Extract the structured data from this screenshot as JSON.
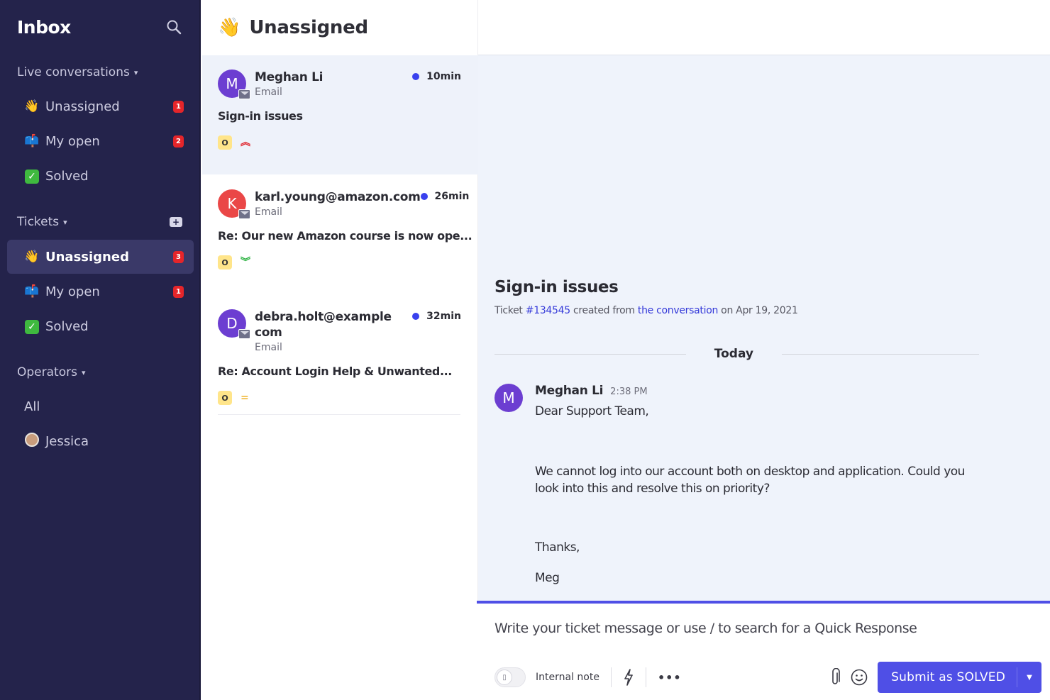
{
  "sidebar": {
    "title": "Inbox",
    "search_icon": "search-icon",
    "sections": {
      "live": {
        "label": "Live conversations",
        "items": [
          {
            "label": "Unassigned",
            "emoji": "👋",
            "badge": "1"
          },
          {
            "label": "My open",
            "emoji": "📫",
            "badge": "2"
          },
          {
            "label": "Solved",
            "emoji": "✓",
            "badge": ""
          }
        ]
      },
      "tickets": {
        "label": "Tickets",
        "add_icon": "new-ticket-icon",
        "items": [
          {
            "label": "Unassigned",
            "emoji": "👋",
            "badge": "3",
            "active": true
          },
          {
            "label": "My open",
            "emoji": "📫",
            "badge": "1"
          },
          {
            "label": "Solved",
            "emoji": "✓",
            "badge": ""
          }
        ]
      },
      "operators": {
        "label": "Operators",
        "items": [
          {
            "label": "All"
          },
          {
            "label": "Jessica"
          }
        ]
      }
    }
  },
  "list": {
    "title": "Unassigned",
    "emoji": "👋",
    "conversations": [
      {
        "initial": "M",
        "name": "Meghan Li",
        "channel": "Email",
        "time": "10min",
        "subject": "Sign-in issues",
        "tag": "O",
        "priority": "high",
        "priority_glyph": "︽",
        "avatar_color": "#6c3ed1",
        "selected": true
      },
      {
        "initial": "K",
        "name": "karl.young@amazon.com",
        "channel": "Email",
        "time": "26min",
        "subject": "Re: Our new Amazon course is now ope...",
        "tag": "O",
        "priority": "low",
        "priority_glyph": "︾",
        "avatar_color": "#ea4747"
      },
      {
        "initial": "D",
        "name": "debra.holt@example com",
        "channel": "Email",
        "time": "32min",
        "subject": "Re: Account Login Help & Unwanted...",
        "tag": "O",
        "priority": "medium",
        "priority_glyph": "=",
        "avatar_color": "#6c3ed1"
      }
    ]
  },
  "ticket": {
    "title": "Sign-in issues",
    "meta_prefix": "Ticket ",
    "ticket_id": "#134545",
    "meta_mid": " created from ",
    "conversation_link": "the conversation",
    "meta_suffix": " on Apr 19, 2021",
    "day_divider": "Today",
    "message": {
      "author_initial": "M",
      "author": "Meghan Li",
      "time": "2:38 PM",
      "lines": [
        "Dear Support Team,",
        "We cannot log into our account both on desktop and application. Could you",
        "look into this and resolve this on priority?",
        "Thanks,",
        "Meg"
      ]
    }
  },
  "composer": {
    "placeholder": "Write your ticket message or use / to search for a Quick Response",
    "internal_note_label": "Internal note",
    "submit_label": "Submit as SOLVED",
    "accent": "#4f4fe6"
  },
  "colors": {
    "sidebar_bg": "#24234b",
    "badge_red": "#e5252a",
    "unread_dot": "#3941ee",
    "priority_high": "#e0262e",
    "priority_low": "#2fb344",
    "priority_medium": "#f0b838"
  }
}
